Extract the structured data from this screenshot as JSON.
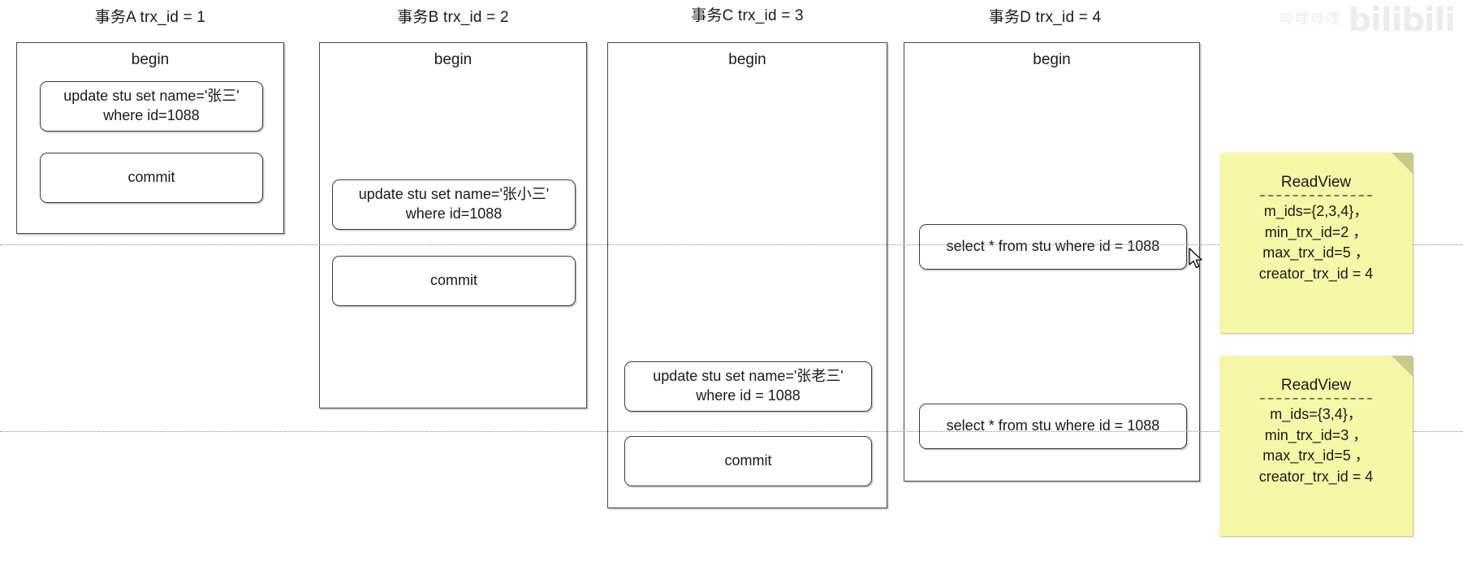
{
  "watermark": {
    "small_text": "哔哩哔哩",
    "brand": "bilibili"
  },
  "columns": [
    {
      "title": "事务A trx_id = 1",
      "begin": "begin",
      "statements": [
        {
          "name": "update-statement",
          "line1": "update stu set name='张三'",
          "line2": "where id=1088"
        },
        {
          "name": "commit-statement",
          "line1": "commit",
          "line2": ""
        }
      ]
    },
    {
      "title": "事务B trx_id = 2",
      "begin": "begin",
      "statements": [
        {
          "name": "update-statement",
          "line1": "update stu set name='张小三'",
          "line2": "where id=1088"
        },
        {
          "name": "commit-statement",
          "line1": "commit",
          "line2": ""
        }
      ]
    },
    {
      "title": "事务C trx_id = 3",
      "begin": "begin",
      "statements": [
        {
          "name": "update-statement",
          "line1": "update stu set name='张老三'",
          "line2": "where id = 1088"
        },
        {
          "name": "commit-statement",
          "line1": "commit",
          "line2": ""
        }
      ]
    },
    {
      "title": "事务D trx_id = 4",
      "begin": "begin",
      "statements": [
        {
          "name": "select-statement",
          "line1": "select * from stu where id = 1088",
          "line2": ""
        },
        {
          "name": "select-statement",
          "line1": "select * from stu where id = 1088",
          "line2": ""
        }
      ]
    }
  ],
  "notes": [
    {
      "title": "ReadView",
      "lines": [
        "m_ids={2,3,4}，",
        "min_trx_id=2 ，",
        "max_trx_id=5 ，",
        "creator_trx_id = 4"
      ]
    },
    {
      "title": "ReadView",
      "lines": [
        "m_ids={3,4}，",
        "min_trx_id=3 ，",
        "max_trx_id=5 ，",
        "creator_trx_id = 4"
      ]
    }
  ],
  "colors": {
    "note_background": "#f7f7a8",
    "note_fold": "#c9c98a",
    "box_border": "#4a4a4a",
    "canvas_background": "#ffffff"
  }
}
